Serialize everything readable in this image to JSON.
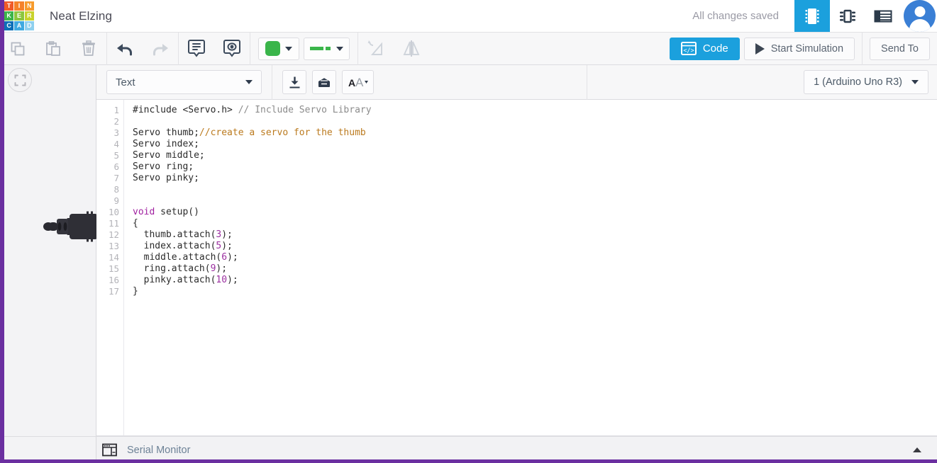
{
  "header": {
    "logo_letters": [
      "T",
      "I",
      "N",
      "K",
      "E",
      "R",
      "C",
      "A",
      "D"
    ],
    "logo_colors": [
      "#f05a28",
      "#f5822a",
      "#f79b2c",
      "#3cb44a",
      "#8cc63e",
      "#c8d22c",
      "#0d6fb8",
      "#3fa9e0",
      "#8fd0ef"
    ],
    "doc_title": "Neat Elzing",
    "save_status": "All changes saved",
    "view_buttons": [
      {
        "name": "components-panel-icon",
        "label": "Components",
        "active": true
      },
      {
        "name": "chip-view-icon",
        "label": "Chip View",
        "active": false
      },
      {
        "name": "list-view-icon",
        "label": "List View",
        "active": false
      }
    ],
    "avatar_label": "User account"
  },
  "toolbar": {
    "copy_label": "Copy",
    "paste_label": "Paste",
    "delete_label": "Delete",
    "undo_label": "Undo",
    "redo_label": "Redo",
    "notes_label": "Notes",
    "annotation_label": "Annotations",
    "wire_color": "#3ab54a",
    "wire_color_label": "Wire Color",
    "wire_type_label": "Wire Type",
    "rotate_label": "Rotate",
    "mirror_label": "Mirror",
    "code_label": "Code",
    "simulation_label": "Start Simulation",
    "send_to_label": "Send To"
  },
  "code_toolbar": {
    "mode_value": "Text",
    "download_label": "Download Code",
    "library_label": "Libraries",
    "font_size_label": "Font Size",
    "font_size_glyphs": [
      "A",
      "A"
    ],
    "board_value": "1 (Arduino Uno R3)"
  },
  "editor": {
    "line_numbers": [
      "1",
      "2",
      "3",
      "4",
      "5",
      "6",
      "7",
      "8",
      "9",
      "10",
      "11",
      "12",
      "13",
      "14",
      "15",
      "16",
      "17"
    ],
    "lines": [
      {
        "n": 1,
        "tokens": [
          {
            "t": "pre",
            "s": "#include <Servo.h> "
          },
          {
            "t": "cmt-gray",
            "s": "// Include Servo Library"
          }
        ]
      },
      {
        "n": 2,
        "tokens": []
      },
      {
        "n": 3,
        "tokens": [
          {
            "t": "pre",
            "s": "Servo thumb;"
          },
          {
            "t": "cmt-org",
            "s": "//create a servo for the thumb"
          }
        ]
      },
      {
        "n": 4,
        "tokens": [
          {
            "t": "pre",
            "s": "Servo index;"
          }
        ]
      },
      {
        "n": 5,
        "tokens": [
          {
            "t": "pre",
            "s": "Servo middle;"
          }
        ]
      },
      {
        "n": 6,
        "tokens": [
          {
            "t": "pre",
            "s": "Servo ring;"
          }
        ]
      },
      {
        "n": 7,
        "tokens": [
          {
            "t": "pre",
            "s": "Servo pinky;"
          }
        ]
      },
      {
        "n": 8,
        "tokens": []
      },
      {
        "n": 9,
        "tokens": []
      },
      {
        "n": 10,
        "tokens": [
          {
            "t": "kw",
            "s": "void"
          },
          {
            "t": "pre",
            "s": " setup()"
          }
        ]
      },
      {
        "n": 11,
        "tokens": [
          {
            "t": "pre",
            "s": "{"
          }
        ]
      },
      {
        "n": 12,
        "tokens": [
          {
            "t": "pre",
            "s": "  thumb.attach("
          },
          {
            "t": "num",
            "s": "3"
          },
          {
            "t": "pre",
            "s": ");"
          }
        ]
      },
      {
        "n": 13,
        "tokens": [
          {
            "t": "pre",
            "s": "  index.attach("
          },
          {
            "t": "num",
            "s": "5"
          },
          {
            "t": "pre",
            "s": ");"
          }
        ]
      },
      {
        "n": 14,
        "tokens": [
          {
            "t": "pre",
            "s": "  middle.attach("
          },
          {
            "t": "num",
            "s": "6"
          },
          {
            "t": "pre",
            "s": ");"
          }
        ]
      },
      {
        "n": 15,
        "tokens": [
          {
            "t": "pre",
            "s": "  ring.attach("
          },
          {
            "t": "num",
            "s": "9"
          },
          {
            "t": "pre",
            "s": ");"
          }
        ]
      },
      {
        "n": 16,
        "tokens": [
          {
            "t": "pre",
            "s": "  pinky.attach("
          },
          {
            "t": "num",
            "s": "10"
          },
          {
            "t": "pre",
            "s": ");"
          }
        ]
      },
      {
        "n": 17,
        "tokens": [
          {
            "t": "pre",
            "s": "}"
          }
        ]
      }
    ]
  },
  "bottom_bar": {
    "serial_monitor_label": "Serial Monitor",
    "collapse_label": "Collapse"
  },
  "canvas": {
    "fit_view_label": "Fit view to selection",
    "component_label": "servo-component"
  },
  "colors": {
    "accent_blue": "#1ba0dd",
    "rail_purple": "#6b2fa0",
    "wire_green": "#3ab54a",
    "toolbar_bg": "#f7f7f8"
  }
}
